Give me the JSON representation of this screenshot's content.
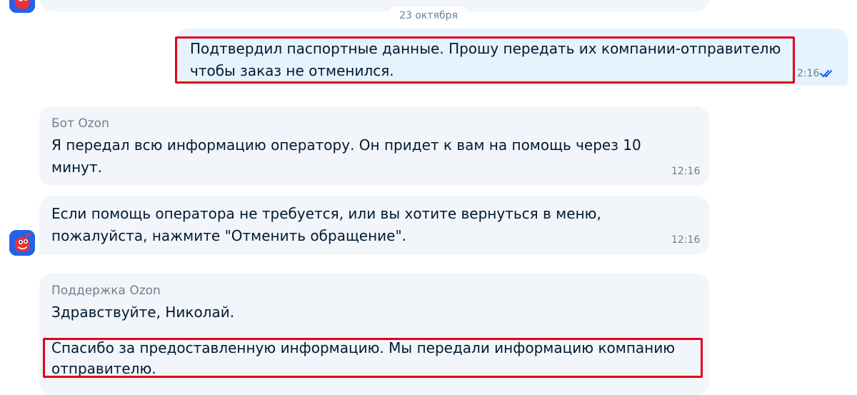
{
  "chat": {
    "date_separator": "23 октября",
    "messages": [
      {
        "direction": "outgoing",
        "lines": [
          "Подтвердил паспортные данные. Прошу передать их компании-отправителю",
          "чтобы заказ не отменился."
        ],
        "time": "2:16",
        "status": "read",
        "status_icon": "double-check-icon"
      },
      {
        "direction": "incoming",
        "sender": "Бот Ozon",
        "lines": [
          "Я передал всю информацию оператору. Он придет к вам на помощь через 10",
          "минут."
        ],
        "time": "12:16"
      },
      {
        "direction": "incoming",
        "lines": [
          "Если помощь оператора не требуется, или вы хотите вернуться в меню,",
          "пожалуйста, нажмите \"Отменить обращение\"."
        ],
        "time": "12:16",
        "avatar_icon": "ozon-mascot-icon"
      },
      {
        "direction": "incoming",
        "sender": "Поддержка Ozon",
        "lines": [
          "Здравствуйте, Николай.",
          "Спасибо за предоставленную информацию. Мы передали информацию компанию",
          "отправителю."
        ]
      }
    ]
  },
  "colors": {
    "incoming_bubble": "#f2f5f9",
    "outgoing_bubble": "#e5f3ff",
    "highlight": "#e3001b",
    "read_check": "#005bff",
    "avatar_bg": "#2462e8"
  }
}
